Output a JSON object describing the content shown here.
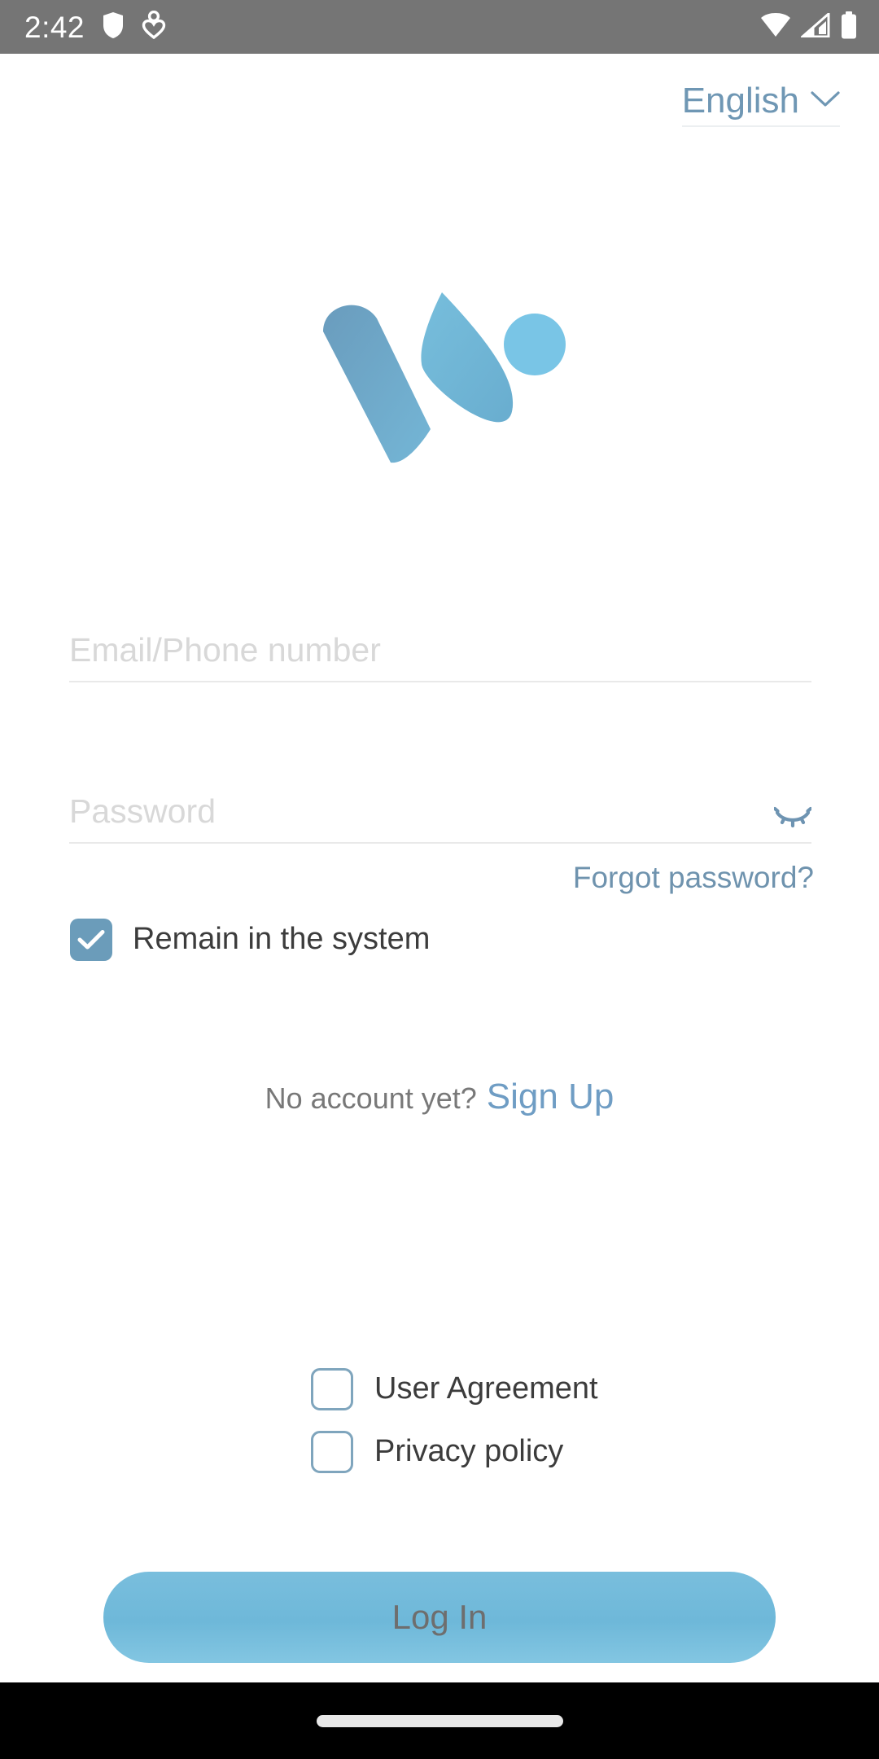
{
  "status_bar": {
    "time": "2:42",
    "left_icons": [
      "shield-icon",
      "person-heart-icon"
    ],
    "right_icons": [
      "wifi-icon",
      "cellular-signal-icon",
      "battery-icon"
    ],
    "background_color": "#757575",
    "foreground_color": "#ffffff"
  },
  "language_selector": {
    "label": "English",
    "icon": "chevron-down-icon",
    "color": "#6f97b4"
  },
  "logo": {
    "name": "app-logo",
    "shapes": [
      "rounded-bar-left",
      "petal-middle",
      "circle-right"
    ],
    "colors": {
      "bar_start": "#6ea3c2",
      "bar_end": "#70b2d3",
      "petal_start": "#74bada",
      "petal_end": "#6fb1d2",
      "circle": "#79c5e6"
    }
  },
  "form": {
    "email": {
      "placeholder": "Email/Phone number",
      "value": ""
    },
    "password": {
      "placeholder": "Password",
      "value": "",
      "toggle_icon": "eye-closed-icon"
    },
    "forgot_password_label": "Forgot password?",
    "remain": {
      "label": "Remain in the system",
      "checked": true,
      "check_color": "#6b9cba"
    }
  },
  "signup": {
    "question": "No account yet?",
    "link_label": "Sign Up",
    "link_color": "#6f9dc4"
  },
  "agreements": [
    {
      "label": "User Agreement",
      "checked": false
    },
    {
      "label": "Privacy policy",
      "checked": false
    }
  ],
  "login_button": {
    "label": "Log In",
    "background_color": "#72bcdc",
    "text_color": "#6e6e6e"
  },
  "nav_bar": {
    "home_indicator": "home-indicator",
    "background_color": "#000000"
  }
}
